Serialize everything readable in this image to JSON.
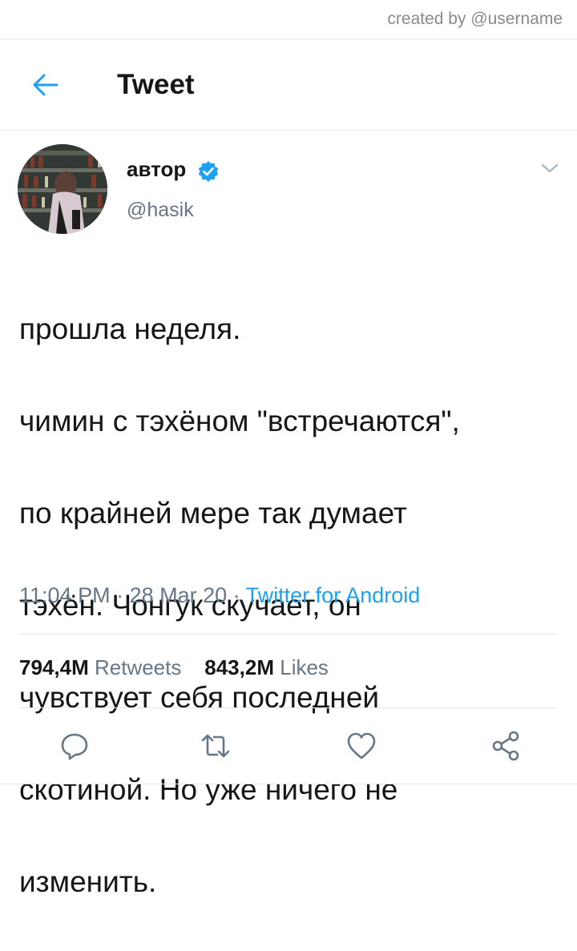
{
  "credit": "created by @username",
  "header": {
    "title": "Tweet"
  },
  "tweet": {
    "author_name": "автор",
    "handle": "@hasik",
    "text_lines": [
      "прошла неделя.",
      "чимин с тэхёном \"встречаются\",",
      "по крайней мере так думает",
      "тэхён. Чонгук скучает, он",
      "чувствует себя последней",
      "скотиной. Но уже ничего не",
      "изменить."
    ],
    "time": "11:04 PM",
    "date": "28 Mar 20",
    "client": "Twitter for Android",
    "separator": " · "
  },
  "stats": {
    "retweets_count": "794,4M",
    "retweets_label": "Retweets",
    "likes_count": "843,2M",
    "likes_label": "Likes"
  },
  "icons": {
    "back": "arrow-left-icon",
    "verified": "verified-badge-icon",
    "menu": "chevron-down-icon",
    "reply": "reply-icon",
    "retweet": "retweet-icon",
    "like": "heart-icon",
    "share": "share-icon"
  },
  "colors": {
    "accent": "#1da1f2",
    "text": "#14171a",
    "muted": "#657786",
    "divider": "#e1e8ed"
  }
}
